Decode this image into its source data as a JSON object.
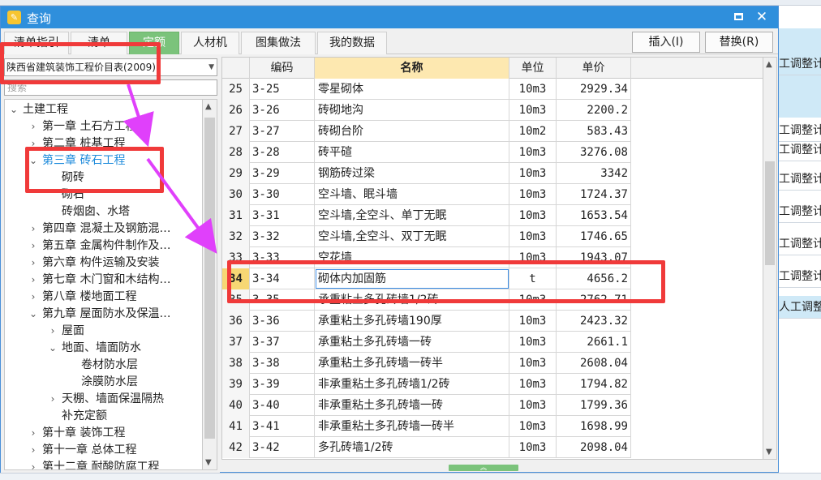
{
  "window": {
    "title": "查询",
    "icon": "app-logo-icon",
    "accent_color": "#2f8fdc"
  },
  "tabs": [
    {
      "label": "清单指引"
    },
    {
      "label": "清单"
    },
    {
      "label": "定额",
      "active": true
    },
    {
      "label": "人材机"
    },
    {
      "label": "图集做法"
    },
    {
      "label": "我的数据"
    }
  ],
  "actions": {
    "insert": "插入(I)",
    "replace": "替换(R)"
  },
  "library": {
    "selected": "陕西省建筑装饰工程价目表(2009)"
  },
  "search": {
    "placeholder": "搜索"
  },
  "tree": [
    {
      "label": "土建工程",
      "level": 0,
      "expanded": true
    },
    {
      "label": "第一章  土石方工程",
      "level": 1,
      "expanded": false
    },
    {
      "label": "第二章  桩基工程",
      "level": 1,
      "expanded": false
    },
    {
      "label": "第三章  砖石工程",
      "level": 1,
      "expanded": true,
      "selected": true
    },
    {
      "label": "砌砖",
      "level": 2
    },
    {
      "label": "砌石",
      "level": 2
    },
    {
      "label": "砖烟囱、水塔",
      "level": 2
    },
    {
      "label": "第四章  混凝土及钢筋混…",
      "level": 1,
      "expanded": false
    },
    {
      "label": "第五章  金属构件制作及…",
      "level": 1,
      "expanded": false
    },
    {
      "label": "第六章  构件运输及安装",
      "level": 1,
      "expanded": false
    },
    {
      "label": "第七章  木门窗和木结构…",
      "level": 1,
      "expanded": false
    },
    {
      "label": "第八章  楼地面工程",
      "level": 1,
      "expanded": false
    },
    {
      "label": "第九章  屋面防水及保温…",
      "level": 1,
      "expanded": true
    },
    {
      "label": "屋面",
      "level": 2,
      "expanded": false
    },
    {
      "label": "地面、墙面防水",
      "level": 2,
      "expanded": true
    },
    {
      "label": "卷材防水层",
      "level": 3
    },
    {
      "label": "涂膜防水层",
      "level": 3
    },
    {
      "label": "天棚、墙面保温隔热",
      "level": 2,
      "expanded": false
    },
    {
      "label": "补充定额",
      "level": 2
    },
    {
      "label": "第十章  装饰工程",
      "level": 1,
      "expanded": false
    },
    {
      "label": "第十一章  总体工程",
      "level": 1,
      "expanded": false
    },
    {
      "label": "第十二章  耐酸防腐工程",
      "level": 1,
      "expanded": false
    }
  ],
  "grid": {
    "columns": [
      "编码",
      "名称",
      "单位",
      "单价"
    ],
    "rows": [
      {
        "idx": "25",
        "code": "3-25",
        "name": "零星砌体",
        "unit": "10m3",
        "price": "2929.34"
      },
      {
        "idx": "26",
        "code": "3-26",
        "name": "砖砌地沟",
        "unit": "10m3",
        "price": "2200.2"
      },
      {
        "idx": "27",
        "code": "3-27",
        "name": "砖砌台阶",
        "unit": "10m2",
        "price": "583.43"
      },
      {
        "idx": "28",
        "code": "3-28",
        "name": "砖平碹",
        "unit": "10m3",
        "price": "3276.08"
      },
      {
        "idx": "29",
        "code": "3-29",
        "name": "钢筋砖过梁",
        "unit": "10m3",
        "price": "3342"
      },
      {
        "idx": "30",
        "code": "3-30",
        "name": "空斗墙、眠斗墙",
        "unit": "10m3",
        "price": "1724.37"
      },
      {
        "idx": "31",
        "code": "3-31",
        "name": "空斗墙,全空斗、单丁无眠",
        "unit": "10m3",
        "price": "1653.54"
      },
      {
        "idx": "32",
        "code": "3-32",
        "name": "空斗墙,全空斗、双丁无眠",
        "unit": "10m3",
        "price": "1746.65"
      },
      {
        "idx": "33",
        "code": "3-33",
        "name": "空花墙",
        "unit": "10m3",
        "price": "1943.07"
      },
      {
        "idx": "34",
        "code": "3-34",
        "name": "砌体内加固筋",
        "unit": "t",
        "price": "4656.2",
        "selected": true
      },
      {
        "idx": "35",
        "code": "3-35",
        "name": "承重粘土多孔砖墙1/2砖",
        "unit": "10m3",
        "price": "2762.71"
      },
      {
        "idx": "36",
        "code": "3-36",
        "name": "承重粘土多孔砖墙190厚",
        "unit": "10m3",
        "price": "2423.32"
      },
      {
        "idx": "37",
        "code": "3-37",
        "name": "承重粘土多孔砖墙一砖",
        "unit": "10m3",
        "price": "2661.1"
      },
      {
        "idx": "38",
        "code": "3-38",
        "name": "承重粘土多孔砖墙一砖半",
        "unit": "10m3",
        "price": "2608.04"
      },
      {
        "idx": "39",
        "code": "3-39",
        "name": "非承重粘土多孔砖墙1/2砖",
        "unit": "10m3",
        "price": "1794.82"
      },
      {
        "idx": "40",
        "code": "3-40",
        "name": "非承重粘土多孔砖墙一砖",
        "unit": "10m3",
        "price": "1799.36"
      },
      {
        "idx": "41",
        "code": "3-41",
        "name": "非承重粘土多孔砖墙一砖半",
        "unit": "10m3",
        "price": "1698.99"
      },
      {
        "idx": "42",
        "code": "3-42",
        "name": "多孔砖墙1/2砖",
        "unit": "10m3",
        "price": "2098.04"
      }
    ]
  },
  "background": {
    "right_cells": [
      "工调整计/",
      "工调整计/",
      "工调整计/",
      "工调整计/",
      "工调整计/",
      "工调整计/",
      "工调整计/",
      "人工调整"
    ]
  },
  "annotation_colors": {
    "box": "#f03a3a",
    "arrow": "#e040fb"
  }
}
